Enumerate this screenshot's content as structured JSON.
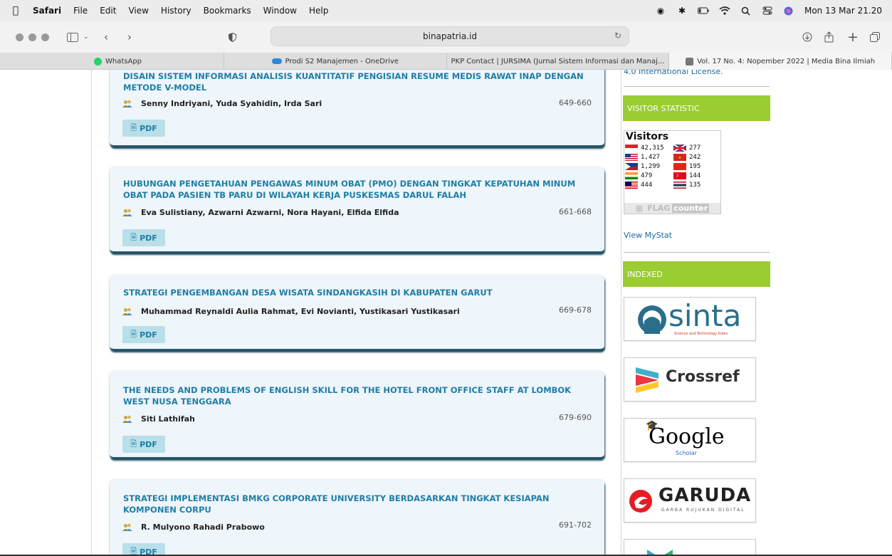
{
  "menubar": {
    "app": "Safari",
    "items": [
      "File",
      "Edit",
      "View",
      "History",
      "Bookmarks",
      "Window",
      "Help"
    ],
    "clock": "Mon 13 Mar  21.20"
  },
  "toolbar": {
    "url": "binapatria.id"
  },
  "tabs": [
    {
      "label": "WhatsApp",
      "icon_color": "#25D366"
    },
    {
      "label": "Prodi S2 Manajemen - OneDrive",
      "icon_color": "#2b8ad9"
    },
    {
      "label": "PKP  Contact | JURSIMA (Jurnal Sistem Informasi dan Manaj...",
      "icon_color": ""
    },
    {
      "label": "Vol. 17 No. 4: Nopember 2022 | Media Bina Ilmiah",
      "icon_color": "#666666"
    }
  ],
  "articles": [
    {
      "title": "DISAIN SISTEM INFORMASI ANALISIS KUANTITATIF PENGISIAN RESUME MEDIS RAWAT INAP DENGAN METODE V-MODEL",
      "authors": "Senny Indriyani, Yuda Syahidin, Irda Sari",
      "pages": "649-660",
      "pdf": "PDF"
    },
    {
      "title": "HUBUNGAN PENGETAHUAN PENGAWAS MINUM OBAT (PMO) DENGAN TINGKAT KEPATUHAN MINUM OBAT PADA PASIEN TB PARU DI WILAYAH KERJA PUSKESMAS DARUL FALAH",
      "authors": "Eva Sulistiany, Azwarni Azwarni, Nora Hayani, Elfida Elfida",
      "pages": "661-668",
      "pdf": "PDF"
    },
    {
      "title": "STRATEGI PENGEMBANGAN DESA WISATA SINDANGKASIH DI KABUPATEN GARUT",
      "authors": "Muhammad Reynaldi Aulia Rahmat, Evi Novianti, Yustikasari Yustikasari",
      "pages": "669-678",
      "pdf": "PDF"
    },
    {
      "title": "THE NEEDS AND PROBLEMS OF ENGLISH SKILL FOR THE HOTEL FRONT OFFICE STAFF AT LOMBOK WEST NUSA TENGGARA",
      "authors": "Siti Lathifah",
      "pages": "679-690",
      "pdf": "PDF"
    },
    {
      "title": "STRATEGI IMPLEMENTASI BMKG CORPORATE UNIVERSITY BERDASARKAN TINGKAT KESIAPAN KOMPONEN CORPU",
      "authors": "R. Mulyono Rahadi Prabowo",
      "pages": "691-702",
      "pdf": "PDF"
    }
  ],
  "sidebar": {
    "license_text": "4.0 International License.",
    "visitor_heading": "VISITOR STATISTIC",
    "visitors_title": "Visitors",
    "visitor_counts": [
      {
        "count": "42,315",
        "flag": "id"
      },
      {
        "count": "277",
        "flag": "gb"
      },
      {
        "count": "1,427",
        "flag": "us"
      },
      {
        "count": "242",
        "flag": "vn"
      },
      {
        "count": "1,299",
        "flag": "ph"
      },
      {
        "count": "195",
        "flag": "cn"
      },
      {
        "count": "479",
        "flag": "in"
      },
      {
        "count": "144",
        "flag": "tr"
      },
      {
        "count": "444",
        "flag": "my"
      },
      {
        "count": "135",
        "flag": "th"
      }
    ],
    "flag_counter_text": "FLAG",
    "flag_counter_text2": "counter",
    "view_mystat": "View MyStat",
    "indexed_heading": "INDEXED",
    "logos": [
      {
        "name": "sinta",
        "text": "sinta",
        "subtext": "Science and Technology Index"
      },
      {
        "name": "crossref",
        "text": "Crossref",
        "subtext": ""
      },
      {
        "name": "google-scholar",
        "text": "Google",
        "subtext": "Scholar"
      },
      {
        "name": "garuda",
        "text": "GARUDA",
        "subtext": "GARBA RUJUKAN DIGITAL"
      }
    ]
  }
}
